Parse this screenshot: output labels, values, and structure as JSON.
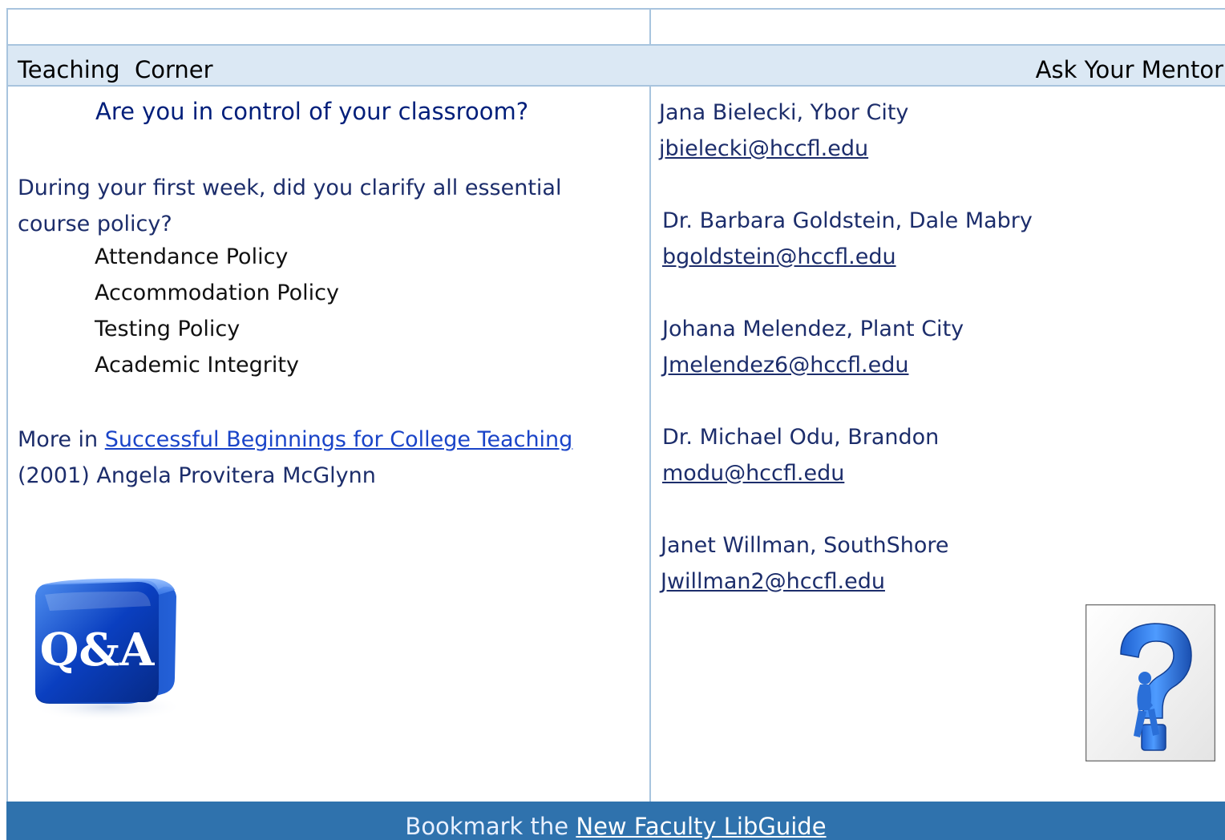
{
  "header": {
    "left_title": "Teaching  Corner",
    "right_title": "Ask Your Mentor"
  },
  "teaching": {
    "subheading": "Are you in control of your classroom?",
    "intro_line1": "During your first week, did you clarify all essential",
    "intro_line2": "course policy?",
    "policies": [
      "Attendance Policy",
      "Accommodation Policy",
      "Testing Policy",
      "Academic Integrity"
    ],
    "more_prefix": "More in ",
    "more_link": "Successful Beginnings for College Teaching",
    "more_citation": "(2001) Angela Provitera McGlynn",
    "image_label": "Q&A"
  },
  "mentors": [
    {
      "name": "Jana Bielecki, Ybor City",
      "email": "jbielecki@hccfl.edu"
    },
    {
      "name": "Dr. Barbara Goldstein, Dale Mabry",
      "email": "bgoldstein@hccfl.edu"
    },
    {
      "name": "Johana Melendez, Plant City",
      "email": "Jmelendez6@hccfl.edu"
    },
    {
      "name": "Dr. Michael Odu, Brandon",
      "email": "modu@hccfl.edu"
    },
    {
      "name": "Janet Willman, SouthShore",
      "email": "Jwillman2@hccfl.edu"
    }
  ],
  "footer": {
    "prefix": "Bookmark the ",
    "link": "New Faculty LibGuide"
  },
  "colors": {
    "header_bg": "#dbe8f4",
    "footer_bg": "#2f72ad",
    "heading_navy": "#001e7a",
    "link_blue": "#1a44c8"
  }
}
